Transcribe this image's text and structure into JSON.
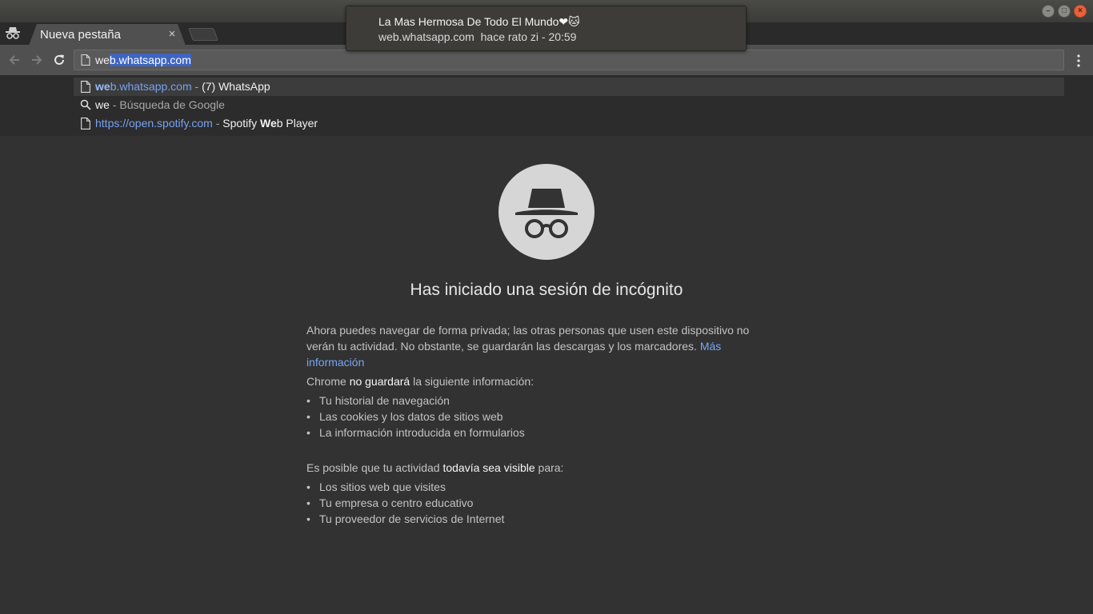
{
  "window": {
    "controls": {
      "minimize": "–",
      "maximize": "□",
      "close": "×"
    }
  },
  "tab": {
    "title": "Nueva pestaña",
    "close": "×"
  },
  "omnibox": {
    "typed": "we",
    "autocomplete": "b.whatsapp.com"
  },
  "suggestions": [
    {
      "icon": "page-icon",
      "url_match": "we",
      "url_rest": "b.whatsapp.com",
      "separator": " - ",
      "title_prefix": "(7) WhatsApp",
      "title_match": "",
      "title_suffix": ""
    },
    {
      "icon": "search-icon",
      "query": "we",
      "separator": " - ",
      "description": "Búsqueda de Google"
    },
    {
      "icon": "page-icon",
      "url": "https://open.spotify.com",
      "separator": " - ",
      "title_prefix": "Spotify ",
      "title_match": "We",
      "title_suffix": "b Player"
    }
  ],
  "notification": {
    "title": "La Mas Hermosa De Todo El Mundo❤🐱",
    "site": "web.whatsapp.com",
    "message": "hace rato zi - 20:59"
  },
  "incognito": {
    "heading": "Has iniciado una sesión de incógnito",
    "intro": "Ahora puedes navegar de forma privada; las otras personas que usen este dispositivo no verán tu actividad. No obstante, se guardarán las descargas y los marcadores.",
    "learn_more": "Más información",
    "not_saved": {
      "prefix": "Chrome ",
      "strong": "no guardará",
      "suffix": " la siguiente información:"
    },
    "not_saved_items": [
      "Tu historial de navegación",
      "Las cookies y los datos de sitios web",
      "La información introducida en formularios"
    ],
    "visible": {
      "prefix": "Es posible que tu actividad ",
      "strong": "todavía sea visible",
      "suffix": " para:"
    },
    "visible_items": [
      "Los sitios web que visites",
      "Tu empresa o centro educativo",
      "Tu proveedor de servicios de Internet"
    ]
  },
  "colors": {
    "background": "#323232",
    "toolbar": "#505050",
    "link": "#79a6f2",
    "selection": "#3f65c2",
    "close_button": "#e9603a"
  }
}
